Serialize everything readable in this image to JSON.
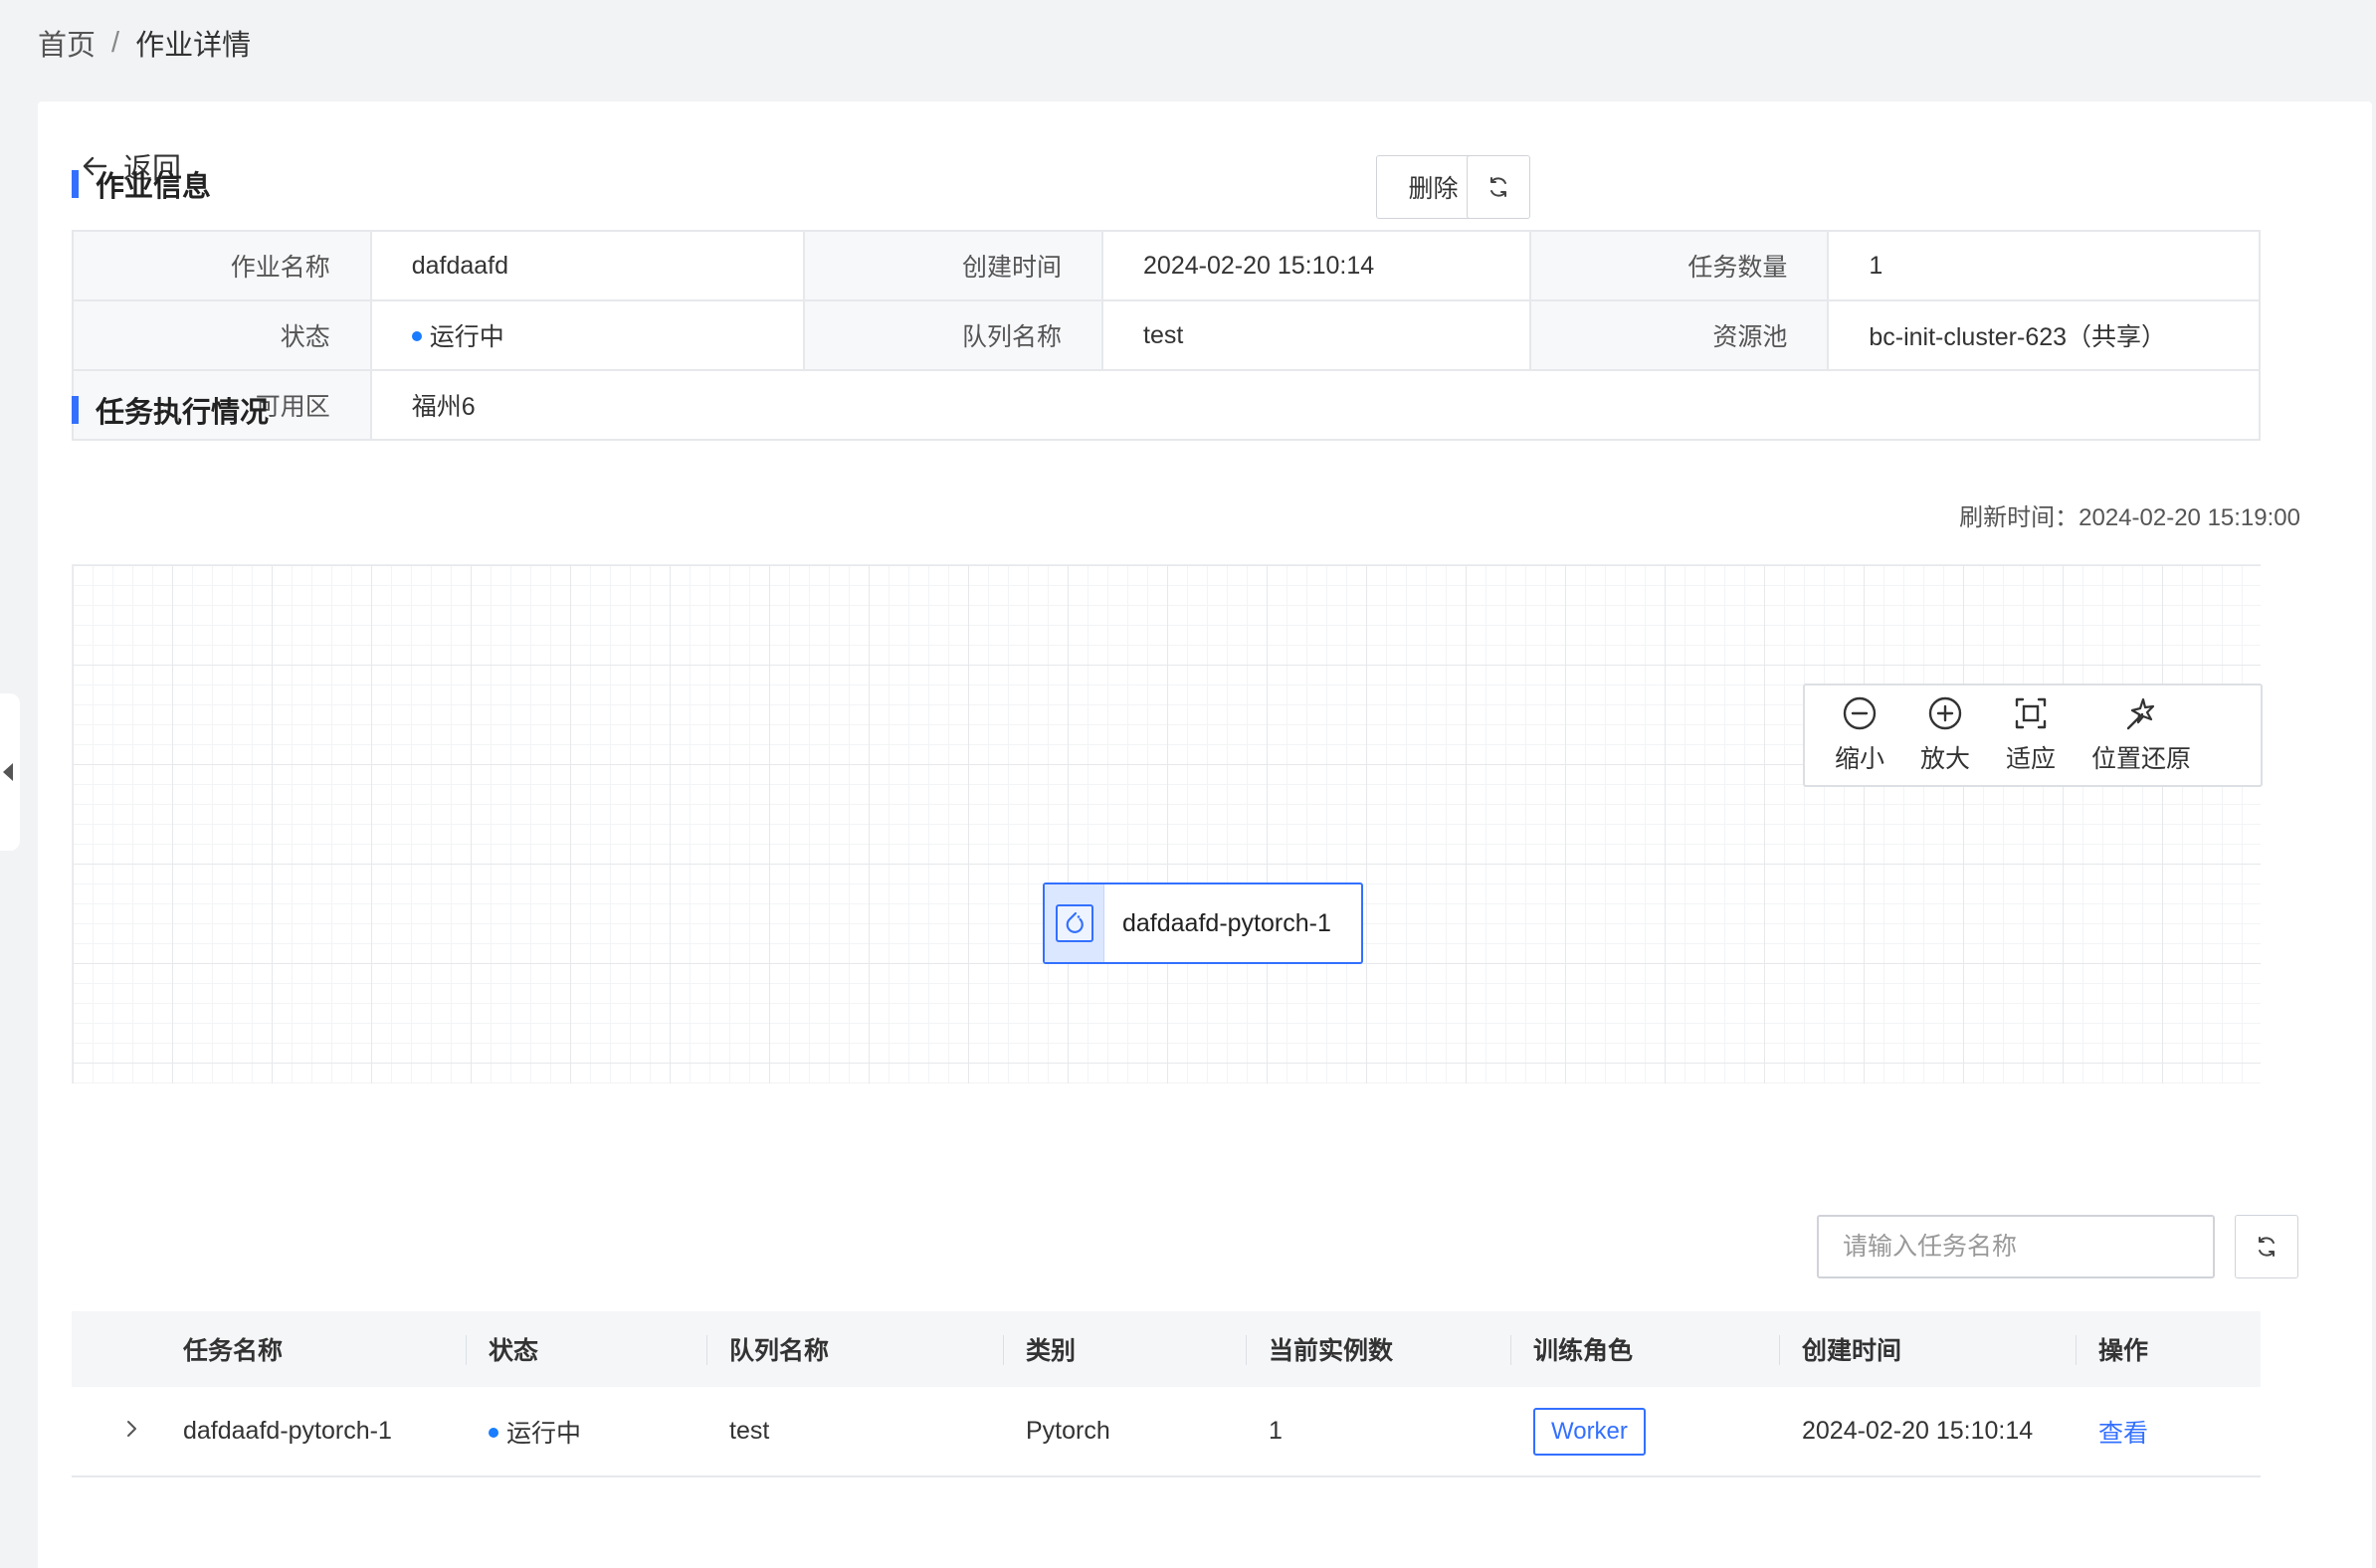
{
  "breadcrumb": {
    "home": "首页",
    "separator": "/",
    "current": "作业详情"
  },
  "back_label": "返回",
  "job_section": {
    "title": "作业信息",
    "delete_label": "删除",
    "refresh_icon": "refresh-icon"
  },
  "job_info": {
    "name_label": "作业名称",
    "name": "dafdaafd",
    "created_label": "创建时间",
    "created": "2024-02-20 15:10:14",
    "task_count_label": "任务数量",
    "task_count": "1",
    "status_label": "状态",
    "status": "运行中",
    "queue_label": "队列名称",
    "queue": "test",
    "pool_label": "资源池",
    "pool": "bc-init-cluster-623（共享）",
    "zone_label": "可用区",
    "zone": "福州6"
  },
  "task_section": {
    "title": "任务执行情况",
    "refresh_time": "刷新时间：2024-02-20 15:19:00"
  },
  "zoom_panel": {
    "zoom_out": "缩小",
    "zoom_in": "放大",
    "fit": "适应",
    "reset": "位置还原"
  },
  "graph_node": {
    "label": "dafdaafd-pytorch-1",
    "icon": "pytorch-icon"
  },
  "task_search": {
    "placeholder": "请输入任务名称"
  },
  "task_table": {
    "headers": [
      "任务名称",
      "状态",
      "队列名称",
      "类别",
      "当前实例数",
      "训练角色",
      "创建时间",
      "操作"
    ],
    "rows": [
      {
        "name": "dafdaafd-pytorch-1",
        "status": "运行中",
        "queue": "test",
        "category": "Pytorch",
        "instances": "1",
        "role": "Worker",
        "created": "2024-02-20 15:10:14",
        "action": "查看"
      }
    ]
  },
  "colors": {
    "accent": "#3370ff",
    "status_dot": "#1a7cff",
    "background": "#f2f3f5"
  }
}
